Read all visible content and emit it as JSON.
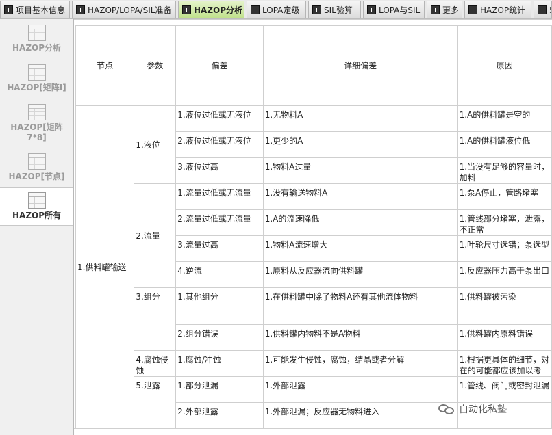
{
  "tabs": [
    {
      "label": "项目基本信息",
      "active": false
    },
    {
      "label": "HAZOP/LOPA/SIL准备",
      "active": false
    },
    {
      "label": "HAZOP分析",
      "active": true
    },
    {
      "label": "LOPA定级",
      "active": false
    },
    {
      "label": "SIL验算",
      "active": false
    },
    {
      "label": "LOPA与SIL",
      "active": false
    },
    {
      "label": "更多",
      "active": false
    },
    {
      "label": "HAZOP统计",
      "active": false
    },
    {
      "label": "5",
      "active": false
    }
  ],
  "sidebar": {
    "items": [
      {
        "label": "HAZOP分析",
        "active": false
      },
      {
        "label": "HAZOP[矩阵I]",
        "active": false
      },
      {
        "label": "HAZOP[矩阵7*8]",
        "active": false
      },
      {
        "label": "HAZOP[节点]",
        "active": false
      },
      {
        "label": "HAZOP所有",
        "active": true
      }
    ]
  },
  "table": {
    "headers": [
      "节点",
      "参数",
      "偏差",
      "详细偏差",
      "原因"
    ],
    "node": "1.供料罐输送",
    "params": [
      "1.液位",
      "2.流量",
      "3.组分",
      "4.腐蚀侵蚀",
      "5.泄露"
    ],
    "rows": [
      {
        "deviation": "1.液位过低或无液位",
        "detail": "1.无物料A",
        "cause": "1.A的供料罐是空的"
      },
      {
        "deviation": "2.液位过低或无液位",
        "detail": "1.更少的A",
        "cause": "1.A的供料罐液位低"
      },
      {
        "deviation": "3.液位过高",
        "detail": "1.物料A过量",
        "cause": "1.当没有足够的容量时，加料"
      },
      {
        "deviation": "1.流量过低或无流量",
        "detail": "1.没有输送物料A",
        "cause": "1.泵A停止，管路堵塞"
      },
      {
        "deviation": "2.流量过低或无流量",
        "detail": "1.A的流速降低",
        "cause": "1.管线部分堵塞，泄露，不正常"
      },
      {
        "deviation": "3.流量过高",
        "detail": "1.物料A流速增大",
        "cause": "1.叶轮尺寸选错；泵选型"
      },
      {
        "deviation": "4.逆流",
        "detail": "1.原料从反应器流向供料罐",
        "cause": "1.反应器压力高于泵出口"
      },
      {
        "deviation": "1.其他组分",
        "detail": "1.在供料罐中除了物料A还有其他流体物料",
        "cause": "1.供料罐被污染"
      },
      {
        "deviation": "2.组分错误",
        "detail": "1.供料罐内物料不是A物料",
        "cause": "1.供料罐内原料错误"
      },
      {
        "deviation": "1.腐蚀/冲蚀",
        "detail": "1.可能发生侵蚀，腐蚀，结晶或者分解",
        "cause": "1.根据更具体的细节，对在的可能都应该加以考"
      },
      {
        "deviation": "1.部分泄漏",
        "detail": "1.外部泄露",
        "cause": "1.管线、阀门或密封泄漏"
      },
      {
        "deviation": "2.外部泄露",
        "detail": "1.外部泄漏；反应器无物料进入",
        "cause": ""
      }
    ]
  },
  "watermark": {
    "text": "自动化私塾"
  }
}
